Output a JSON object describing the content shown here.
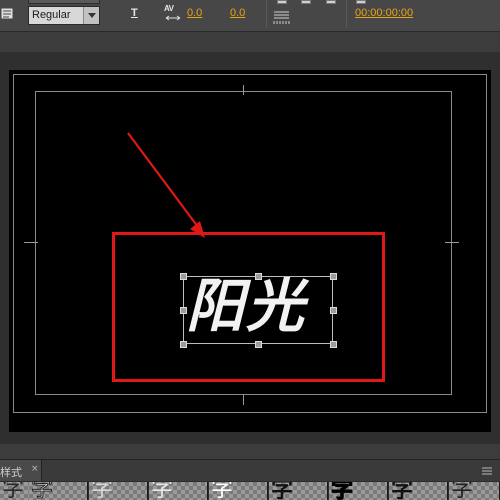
{
  "toolbar": {
    "font_style": "Regular",
    "underline_label": "T",
    "kerning_label": "AV",
    "kerning_value": "0.0",
    "leading_value": "0.0",
    "timecode": "00:00:00:00"
  },
  "canvas": {
    "title_text": "阳光"
  },
  "bottom_panel": {
    "tab_label": "样式",
    "close_glyph": "×",
    "swatch_glyph": "字"
  },
  "colors": {
    "accent": "#e8a317",
    "highlight_box": "#e01818"
  }
}
